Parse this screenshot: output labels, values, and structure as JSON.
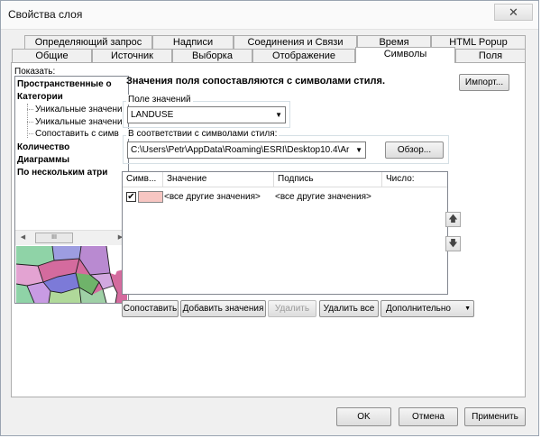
{
  "window": {
    "title": "Свойства слоя",
    "close_glyph": "✕"
  },
  "tabs_back": [
    "Определяющий запрос",
    "Надписи",
    "Соединения и Связи",
    "Время",
    "HTML Popup"
  ],
  "tabs_front": [
    "Общие",
    "Источник",
    "Выборка",
    "Отображение",
    "Символы",
    "Поля"
  ],
  "active_tab": "Символы",
  "show": {
    "label": "Показать:",
    "tree": {
      "features": "Пространственные о",
      "categories": "Категории",
      "unique_values": "Уникальные значени",
      "unique_values_many": "Уникальные значени",
      "match_to_style": "Сопоставить с симв",
      "quantities": "Количество",
      "charts": "Диаграммы",
      "multiple": "По нескольким атри"
    },
    "scroll_thumb": "III"
  },
  "symbology": {
    "heading": "Значения поля сопоставляются с символами стиля.",
    "import_button": "Импорт...",
    "value_field": {
      "label": "Поле значений",
      "value": "LANDUSE"
    },
    "style": {
      "label": "В соответствии с символами стиля:",
      "value": "C:\\Users\\Petr\\AppData\\Roaming\\ESRI\\Desktop10.4\\Ar",
      "browse_button": "Обзор..."
    },
    "table": {
      "columns": [
        "Симв...",
        "Значение",
        "Подпись",
        "Число:"
      ],
      "rows": [
        {
          "checked": "✔",
          "value": "<все другие значения>",
          "label": "<все другие значения>",
          "count": ""
        }
      ],
      "swatch_color": "#f7c6c2"
    },
    "move_up": "🡅",
    "move_down": "🡇",
    "buttons": {
      "match": "Сопоставить",
      "add_values": "Добавить значения",
      "remove": "Удалить",
      "remove_all": "Удалить все",
      "advanced": "Дополнительно"
    }
  },
  "footer": {
    "ok": "OK",
    "cancel": "Отмена",
    "apply": "Применить"
  }
}
